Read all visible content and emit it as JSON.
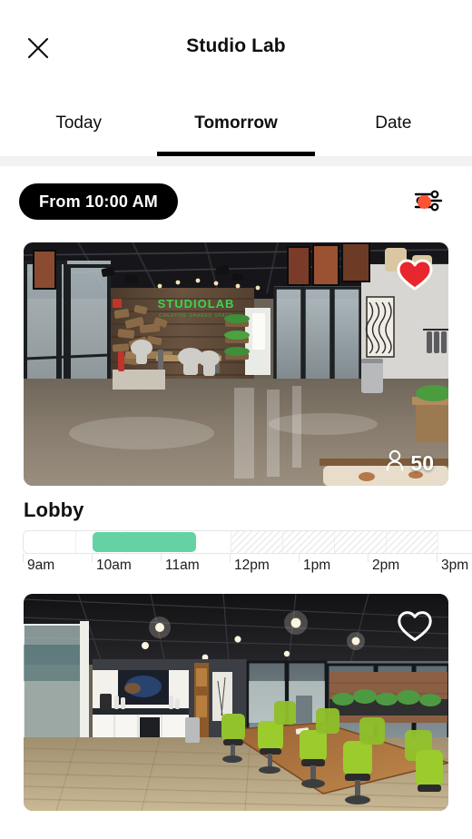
{
  "header": {
    "title": "Studio Lab",
    "close_icon": "close-icon"
  },
  "tabs": [
    {
      "label": "Today",
      "active": false
    },
    {
      "label": "Tomorrow",
      "active": true
    },
    {
      "label": "Date",
      "active": false
    }
  ],
  "filter_bar": {
    "time_pill_label": "From 10:00 AM",
    "filter_icon": "sliders-icon",
    "badge_visible": true,
    "badge_color": "#fb5434"
  },
  "colors": {
    "accent_black": "#000000",
    "booked_green": "#65d2a3",
    "badge_red": "#fb5434",
    "favorite_red": "#e8262d",
    "divider_gray": "#f1f2f3"
  },
  "rooms": [
    {
      "name": "Lobby",
      "favorite": true,
      "favorite_icon": "heart-filled-icon",
      "capacity": "50",
      "capacity_icon": "person-icon",
      "photo_alt": "studio-lab-lobby-photo",
      "timeline": {
        "hours": [
          "9am",
          "10am",
          "11am",
          "12pm",
          "1pm",
          "2pm",
          "3pm"
        ],
        "booked_start": "10am",
        "booked_end": "12pm",
        "unavailable_start": "12pm",
        "unavailable_end": "3pm"
      }
    },
    {
      "name": "",
      "favorite": false,
      "favorite_icon": "heart-outline-icon",
      "capacity": "",
      "capacity_icon": "person-icon",
      "photo_alt": "studio-lab-boardroom-photo",
      "timeline": null
    }
  ]
}
